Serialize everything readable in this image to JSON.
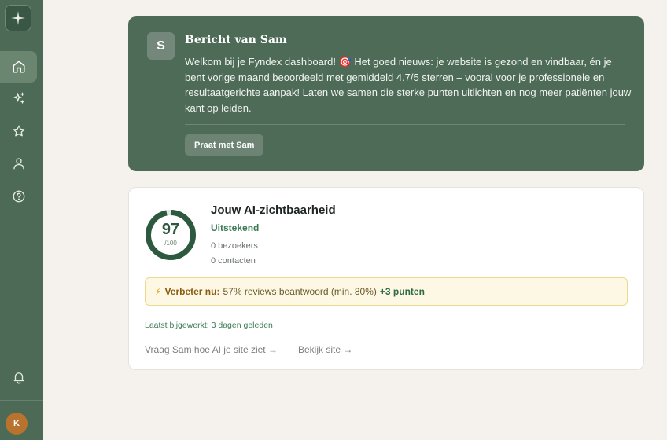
{
  "sidebar": {
    "logo_icon": "compass-star-icon",
    "items": [
      {
        "icon": "home-icon",
        "active": true
      },
      {
        "icon": "sparkles-icon",
        "active": false
      },
      {
        "icon": "star-icon",
        "active": false
      },
      {
        "icon": "user-icon",
        "active": false
      },
      {
        "icon": "help-circle-icon",
        "active": false
      }
    ],
    "bell_icon": "bell-icon",
    "avatar_initial": "K",
    "avatar_color": "#b8732f"
  },
  "message": {
    "avatar_letter": "S",
    "title": "Bericht van Sam",
    "body": "Welkom bij je Fyndex dashboard! 🎯 Het goed nieuws: je website is gezond en vindbaar, én je bent vorige maand beoordeeld met gemiddeld 4.7/5 sterren – vooral voor je professionele en resultaatgerichte aanpak! Laten we samen die sterke punten uitlichten en nog meer patiënten jouw kant op leiden.",
    "button_label": "Praat met Sam",
    "card_color": "#4e6b57"
  },
  "visibility": {
    "score": "97",
    "score_max": "/100",
    "score_fraction": 0.97,
    "title": "Jouw AI-zichtbaarheid",
    "status": "Uitstekend",
    "visitors": "0 bezoekers",
    "contacts": "0 contacten",
    "tip": {
      "label": "Verbeter nu:",
      "text": "57% reviews beantwoord (min. 80%)",
      "points": "+3 punten"
    },
    "updated": "Laatst bijgewerkt: 3 dagen geleden",
    "link_ask": "Vraag Sam hoe AI je site ziet →",
    "link_view": "Bekijk site →",
    "accent_color": "#2d5a3f"
  }
}
